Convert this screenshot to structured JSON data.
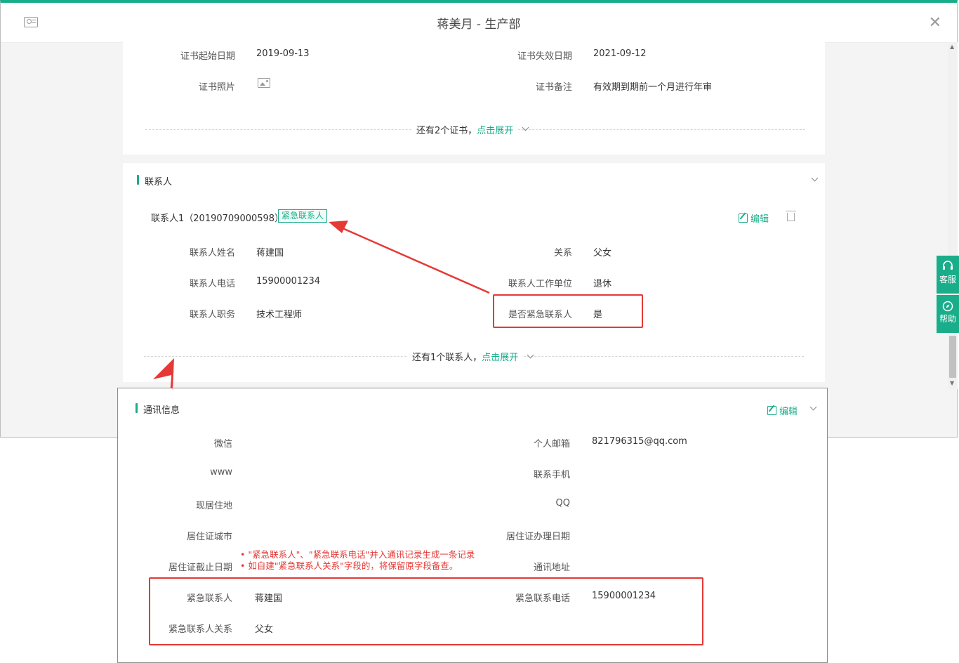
{
  "window": {
    "title": "蒋美月 - 生产部"
  },
  "certificate": {
    "start_date_label": "证书起始日期",
    "start_date": "2019-09-13",
    "end_date_label": "证书失效日期",
    "end_date": "2021-09-12",
    "photo_label": "证书照片",
    "remark_label": "证书备注",
    "remark": "有效期到期前一个月进行年审",
    "more_text": "还有2个证书，",
    "expand_link": "点击展开"
  },
  "contacts": {
    "section_title": "联系人",
    "contact_header": "联系人1（20190709000598）",
    "badge": "紧急联系人",
    "edit_label": "编辑",
    "fields": {
      "name_label": "联系人姓名",
      "name": "蒋建国",
      "relation_label": "关系",
      "relation": "父女",
      "phone_label": "联系人电话",
      "phone": "15900001234",
      "work_label": "联系人工作单位",
      "work": "退休",
      "position_label": "联系人职务",
      "position": "技术工程师",
      "emergency_label": "是否紧急联系人",
      "emergency": "是"
    },
    "more_text": "还有1个联系人，",
    "expand_link": "点击展开"
  },
  "side_tools": {
    "service": "客服",
    "help": "帮助"
  },
  "communication": {
    "section_title": "通讯信息",
    "edit_label": "编辑",
    "wechat_label": "微信",
    "email_label": "个人邮箱",
    "email": "821796315@qq.com",
    "www_label": "www",
    "mobile_label": "联系手机",
    "address_label": "现居住地",
    "qq_label": "QQ",
    "permit_city_label": "居住证城市",
    "permit_date_label": "居住证办理日期",
    "permit_expiry_label": "居住证截止日期",
    "mail_address_label": "通讯地址",
    "emergency_contact_label": "紧急联系人",
    "emergency_contact": "蒋建国",
    "emergency_phone_label": "紧急联系电话",
    "emergency_phone": "15900001234",
    "emergency_relation_label": "紧急联系人关系",
    "emergency_relation": "父女"
  },
  "annotations": {
    "note_line1": "• \"紧急联系人\"、\"紧急联系电话\"并入通讯记录生成一条记录",
    "note_line2": "• 如自建\"紧急联系人关系\"字段的，将保留原字段备查。"
  },
  "colors": {
    "accent": "#1aad8a",
    "annotation": "#e53935"
  }
}
